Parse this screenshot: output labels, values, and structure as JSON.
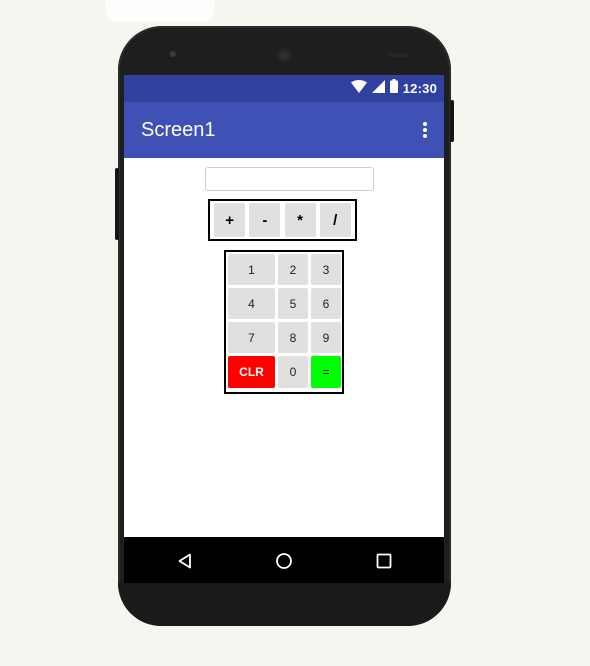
{
  "status_bar": {
    "time": "12:30",
    "icons": [
      "wifi-icon",
      "cell-signal-icon",
      "battery-icon"
    ]
  },
  "app_bar": {
    "title": "Screen1",
    "menu_icon": "more-vert-icon"
  },
  "display": {
    "value": "",
    "placeholder": ""
  },
  "operators": [
    "+",
    "-",
    "*",
    "/"
  ],
  "keypad": {
    "rows": [
      [
        "1",
        "2",
        "3"
      ],
      [
        "4",
        "5",
        "6"
      ],
      [
        "7",
        "8",
        "9"
      ],
      [
        "CLR",
        "0",
        "="
      ]
    ]
  },
  "nav_bar": {
    "icons": [
      "back-icon",
      "home-icon",
      "recents-icon"
    ]
  },
  "colors": {
    "status_bar": "#3041a0",
    "app_bar": "#3f51b5",
    "clear_button": "#ff0000",
    "equals_button": "#00ff00",
    "button_gray": "#e0e0e0"
  }
}
